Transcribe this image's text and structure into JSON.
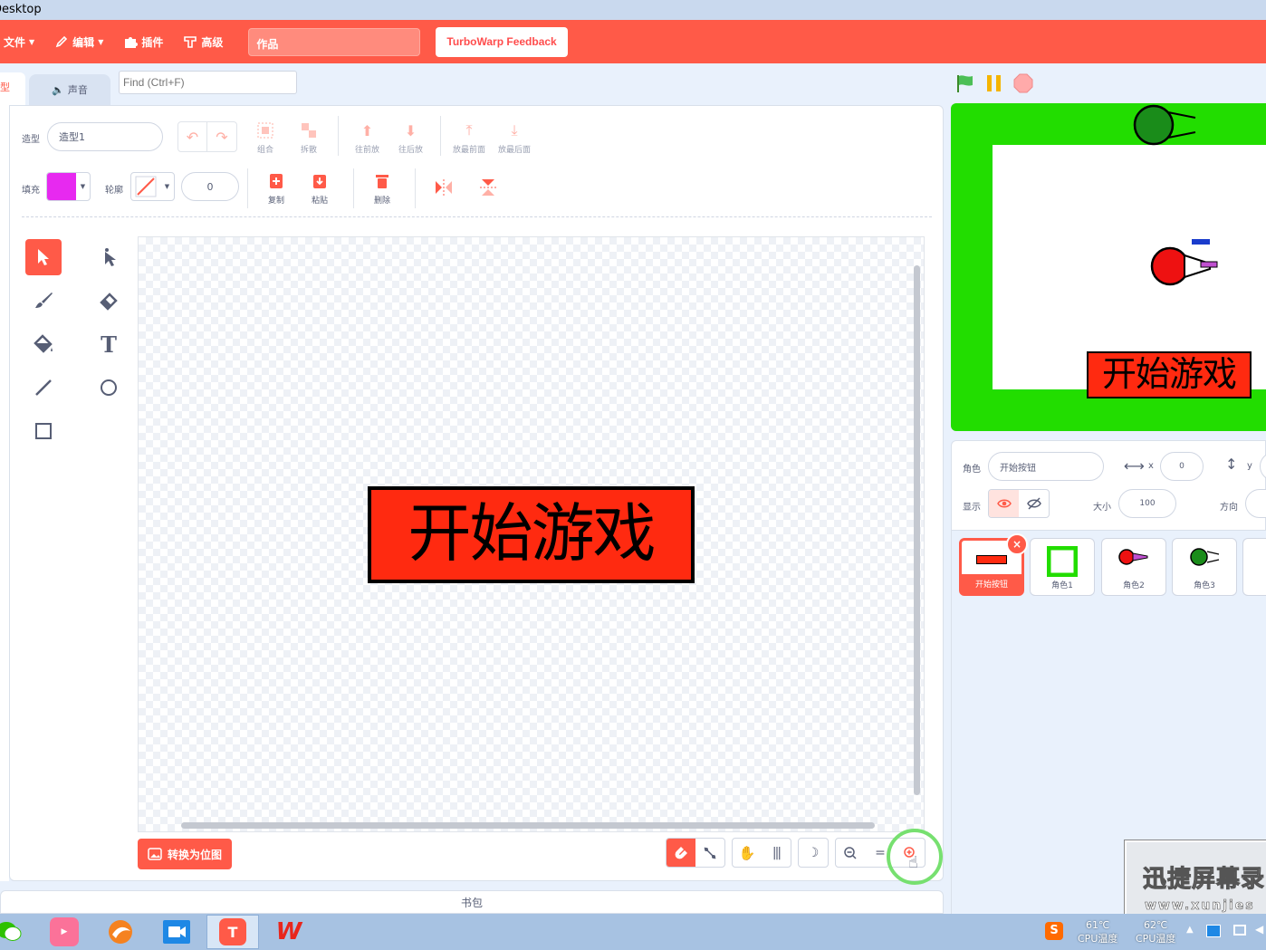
{
  "window": {
    "title": "Desktop"
  },
  "menubar": {
    "items": [
      {
        "label": "文件"
      },
      {
        "label": "编辑"
      },
      {
        "label": "插件"
      },
      {
        "label": "高级"
      }
    ],
    "project_title": "作品",
    "feedback": "TurboWarp Feedback"
  },
  "tabs": {
    "costumes_partial": "型",
    "sounds": "声音",
    "find_placeholder": "Find (Ctrl+F)"
  },
  "paint": {
    "costume_label": "造型",
    "costume_name": "造型1",
    "group": "组合",
    "ungroup": "拆散",
    "forward": "往前放",
    "backward": "往后放",
    "front": "放最前面",
    "back": "放最后面",
    "fill_label": "填充",
    "outline_label": "轮廓",
    "outline_width": "0",
    "copy": "复制",
    "paste": "粘贴",
    "delete": "删除",
    "fill_color": "#e729f0",
    "costume_text": "开始游戏",
    "convert": "转换为位图"
  },
  "backpack": "书包",
  "stage": {
    "button_text": "开始游戏"
  },
  "sprite_info": {
    "sprite_label": "角色",
    "sprite_name": "开始按钮",
    "x_label": "x",
    "x_value": "0",
    "y_label": "y",
    "show_label": "显示",
    "size_label": "大小",
    "size_value": "100",
    "direction_label": "方向"
  },
  "sprites": [
    {
      "name": "开始按钮",
      "selected": true
    },
    {
      "name": "角色1"
    },
    {
      "name": "角色2"
    },
    {
      "name": "角色3"
    }
  ],
  "watermark": {
    "line1": "迅捷屏幕录",
    "line2": "www.xunjies"
  },
  "taskbar": {
    "temp1_value": "61℃",
    "temp1_label": "CPU温度",
    "temp2_value": "62℃",
    "temp2_label": "CPU温度"
  },
  "colors": {
    "accent": "#ff5a48",
    "stage_green": "#22dd00"
  }
}
